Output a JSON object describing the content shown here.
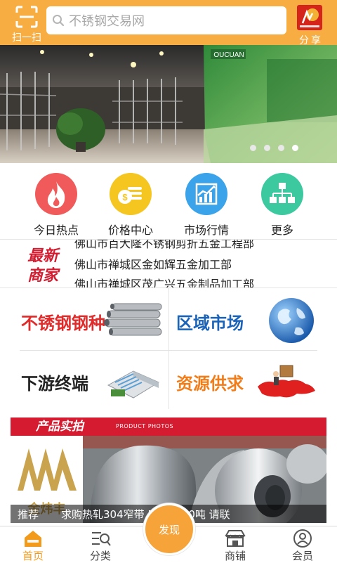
{
  "header": {
    "scan_label": "扫一扫",
    "search_placeholder": "不锈钢交易网",
    "share_label": "分享"
  },
  "quick_nav": [
    {
      "label": "今日热点",
      "icon": "flame-icon",
      "color": "#f05a5a"
    },
    {
      "label": "价格中心",
      "icon": "coin-icon",
      "color": "#f5c520"
    },
    {
      "label": "市场行情",
      "icon": "trend-chart-icon",
      "color": "#3aa3ea"
    },
    {
      "label": "更多",
      "icon": "sitemap-icon",
      "color": "#3cc9a0"
    }
  ],
  "merchants": {
    "logo_text": [
      "最新",
      "商家"
    ],
    "lines": [
      "佛山市百大隆不锈钢剪折五金工程部",
      "佛山市禅城区金如辉五金加工部",
      "佛山市禅城区茂广兴五金制品加工部"
    ]
  },
  "categories": [
    {
      "label": "不锈钢钢种",
      "color": "#e02b2b"
    },
    {
      "label": "区域市场",
      "color": "#1a63b8"
    },
    {
      "label": "下游终端",
      "color": "#222222"
    },
    {
      "label": "资源供求",
      "color": "#f07d1a"
    }
  ],
  "product_photos": {
    "title": "产品实拍",
    "subtitle": "PRODUCT PHOTOS",
    "brand": "金炜丰",
    "caption_tag": "推荐",
    "caption_text": "求购热轧304窄带 510宽 50吨  请联"
  },
  "tabbar": {
    "tabs": [
      {
        "label": "首页",
        "icon": "home-icon",
        "active": true
      },
      {
        "label": "分类",
        "icon": "category-search-icon",
        "active": false
      },
      {
        "label": "商铺",
        "icon": "shop-icon",
        "active": false
      },
      {
        "label": "会员",
        "icon": "user-icon",
        "active": false
      }
    ],
    "discover_label": "发现"
  },
  "colors": {
    "header_bg": "#f7ad41",
    "accent_orange": "#f29a1c",
    "brand_red": "#d51b2f"
  }
}
